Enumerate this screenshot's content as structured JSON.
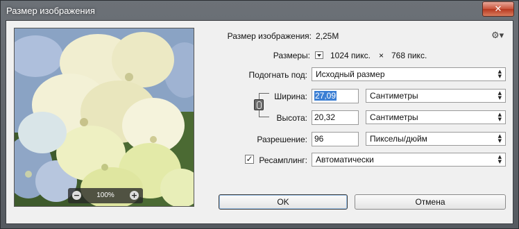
{
  "window": {
    "title": "Размер изображения",
    "close_glyph": "✕"
  },
  "preview": {
    "zoom_out_glyph": "−",
    "zoom_in_glyph": "+",
    "zoom_level": "100%"
  },
  "image_size": {
    "label": "Размер изображения:",
    "value": "2,25M"
  },
  "settings_icon": "gear-icon",
  "dimensions": {
    "label": "Размеры:",
    "width": "1024 пикс.",
    "times": "×",
    "height": "768 пикс."
  },
  "fit_to": {
    "label": "Подогнать под:",
    "value": "Исходный размер"
  },
  "width": {
    "label": "Ширина:",
    "value": "27,09",
    "unit": "Сантиметры"
  },
  "height": {
    "label": "Высота:",
    "value": "20,32",
    "unit": "Сантиметры"
  },
  "resolution": {
    "label": "Разрешение:",
    "value": "96",
    "unit": "Пикселы/дюйм"
  },
  "resample": {
    "checked": true,
    "check_glyph": "✓",
    "label": "Ресамплинг:",
    "value": "Автоматически"
  },
  "buttons": {
    "ok": "OK",
    "cancel": "Отмена"
  },
  "arrows": {
    "up": "▲",
    "down": "▼"
  },
  "colors": {
    "selection": "#3b7fd4",
    "title_text": "#ffffff",
    "dialog_bg": "#f0f0f0"
  }
}
